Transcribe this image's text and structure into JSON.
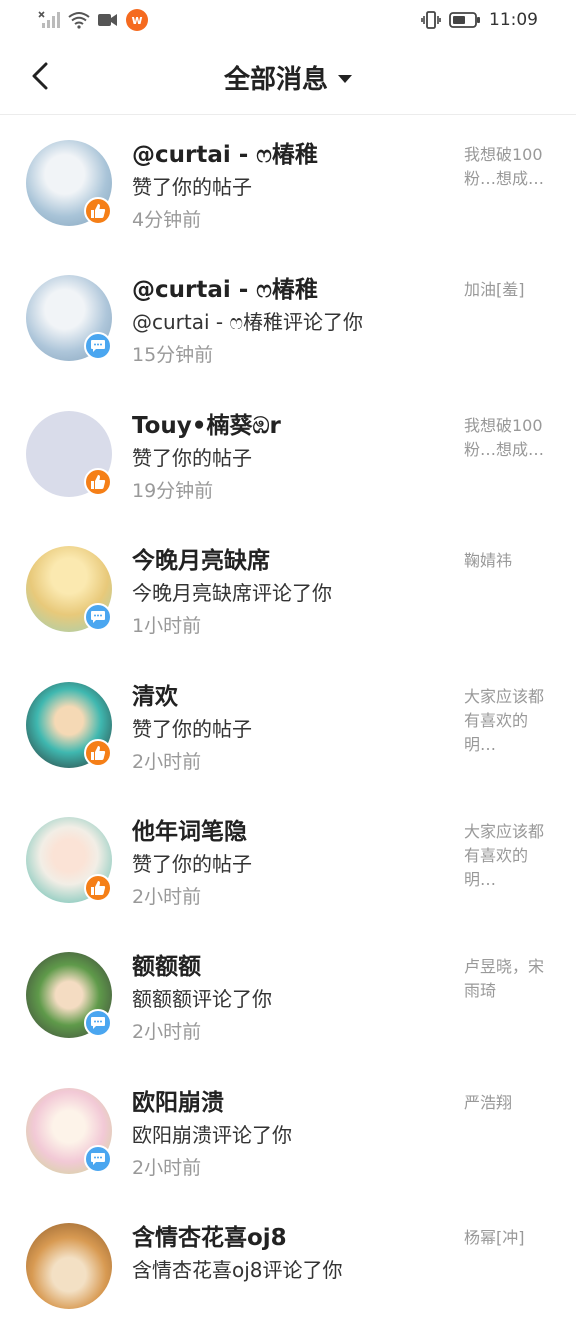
{
  "status_bar": {
    "time": "11:09",
    "left_icons": [
      "no-sim-signal-icon",
      "wifi-icon",
      "video-camera-icon",
      "weibo-app-icon"
    ],
    "right_icons": [
      "vibrate-icon",
      "battery-icon"
    ]
  },
  "header": {
    "title": "全部消息",
    "back_icon": "back-arrow-icon",
    "dropdown_icon": "caret-down-icon"
  },
  "messages": [
    {
      "name": "@curtai - ෆ椿稚",
      "action": "赞了你的帖子",
      "time": "4分钟前",
      "preview": "我想破100粉…想成…",
      "badge": "like",
      "avatar_color": "#a9c4d8"
    },
    {
      "name": "@curtai - ෆ椿稚",
      "action": "@curtai - ෆ椿稚评论了你",
      "time": "15分钟前",
      "preview": "加油[羞]",
      "badge": "comment",
      "avatar_color": "#aec6da"
    },
    {
      "name": "Touy•楠葵ඹr",
      "action": "赞了你的帖子",
      "time": "19分钟前",
      "preview": "我想破100粉…想成…",
      "badge": "like",
      "avatar_color": "#d9dcea"
    },
    {
      "name": "今晚月亮缺席",
      "action": "今晚月亮缺席评论了你",
      "time": "1小时前",
      "preview": "鞠婧祎",
      "badge": "comment",
      "avatar_color": "#e8c97a"
    },
    {
      "name": "清欢",
      "action": "赞了你的帖子",
      "time": "2小时前",
      "preview": "大家应该都有喜欢的明…",
      "badge": "like",
      "avatar_color": "#3fb8b0"
    },
    {
      "name": "他年词笔隐",
      "action": "赞了你的帖子",
      "time": "2小时前",
      "preview": "大家应该都有喜欢的明…",
      "badge": "like",
      "avatar_color": "#4fb6a8"
    },
    {
      "name": "额额额",
      "action": "额额额评论了你",
      "time": "2小时前",
      "preview": "卢昱晓，宋雨琦",
      "badge": "comment",
      "avatar_color": "#5f9a4a"
    },
    {
      "name": "欧阳崩溃",
      "action": "欧阳崩溃评论了你",
      "time": "2小时前",
      "preview": "严浩翔",
      "badge": "comment",
      "avatar_color": "#f2c9d6"
    },
    {
      "name": "含情杏花喜oj8",
      "action": "含情杏花喜oj8评论了你",
      "time": "",
      "preview": "杨幂[冲]",
      "badge": "comment",
      "avatar_color": "#d89a52"
    }
  ]
}
